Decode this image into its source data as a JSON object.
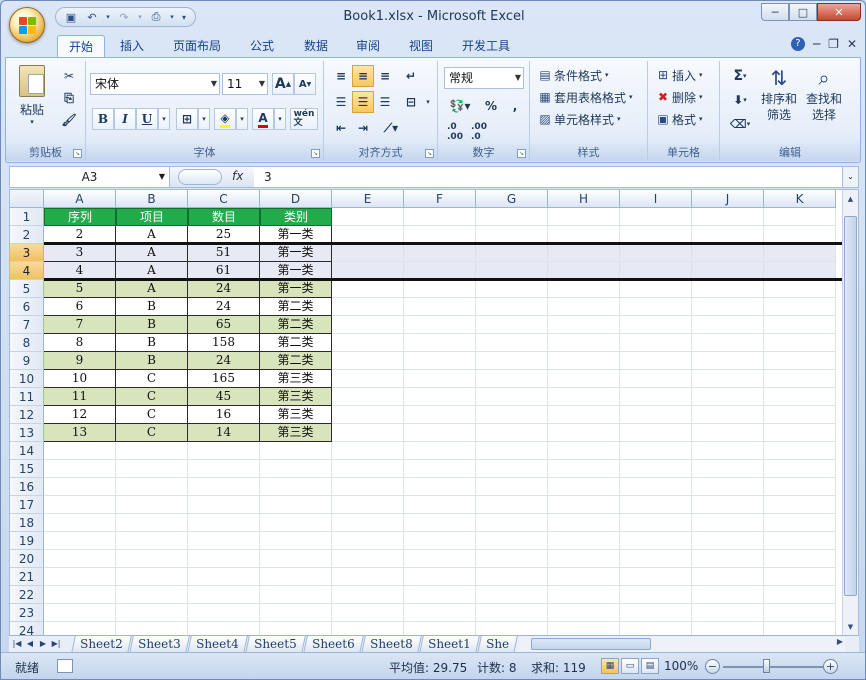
{
  "app": {
    "title": "Book1.xlsx - Microsoft Excel",
    "accent": "#22ab4a",
    "banded_fill": "#d8e4bc"
  },
  "qat": {
    "items": [
      "save-icon",
      "undo-icon",
      "redo-icon",
      "print-preview-icon",
      "customize-icon"
    ]
  },
  "window_controls": {
    "minimize": "─",
    "maximize": "□",
    "close": "✕"
  },
  "tabs": [
    "开始",
    "插入",
    "页面布局",
    "公式",
    "数据",
    "审阅",
    "视图",
    "开发工具"
  ],
  "active_tab": "开始",
  "ribbon": {
    "clipboard": {
      "label": "剪贴板",
      "paste": "粘贴"
    },
    "font": {
      "label": "字体",
      "name": "宋体",
      "size": "11",
      "grow": "A",
      "shrink": "A",
      "bold": "B",
      "italic": "I",
      "underline": "U",
      "color_a": "A",
      "phonetic": "wén\n文"
    },
    "alignment": {
      "label": "对齐方式"
    },
    "number": {
      "label": "数字",
      "format": "常规",
      "percent": "%",
      "comma": ","
    },
    "styles": {
      "label": "样式",
      "conditional": "条件格式",
      "table": "套用表格格式",
      "cell": "单元格样式"
    },
    "cells": {
      "label": "单元格",
      "insert": "插入",
      "delete": "删除",
      "format": "格式"
    },
    "editing": {
      "label": "编辑",
      "sort_filter": "排序和\n筛选",
      "find_select": "查找和\n选择",
      "sum": "Σ"
    }
  },
  "formula_bar": {
    "name_box": "A3",
    "fx": "fx",
    "value": "3"
  },
  "columns": [
    "A",
    "B",
    "C",
    "D",
    "E",
    "F",
    "G",
    "H",
    "I",
    "J",
    "K"
  ],
  "rows": [
    "1",
    "2",
    "3",
    "4",
    "5",
    "6",
    "7",
    "8",
    "9",
    "10",
    "11",
    "12",
    "13",
    "14",
    "15",
    "16",
    "17",
    "18",
    "19",
    "20",
    "21",
    "22",
    "23",
    "24"
  ],
  "table": {
    "header": [
      "序列",
      "项目",
      "数目",
      "类别"
    ],
    "data": [
      [
        "2",
        "A",
        "25",
        "第一类"
      ],
      [
        "3",
        "A",
        "51",
        "第一类"
      ],
      [
        "4",
        "A",
        "61",
        "第一类"
      ],
      [
        "5",
        "A",
        "24",
        "第一类"
      ],
      [
        "6",
        "B",
        "24",
        "第二类"
      ],
      [
        "7",
        "B",
        "65",
        "第二类"
      ],
      [
        "8",
        "B",
        "158",
        "第二类"
      ],
      [
        "9",
        "B",
        "24",
        "第二类"
      ],
      [
        "10",
        "C",
        "165",
        "第三类"
      ],
      [
        "11",
        "C",
        "45",
        "第三类"
      ],
      [
        "12",
        "C",
        "16",
        "第三类"
      ],
      [
        "13",
        "C",
        "14",
        "第三类"
      ]
    ]
  },
  "sheets": [
    "Sheet2",
    "Sheet3",
    "Sheet4",
    "Sheet5",
    "Sheet6",
    "Sheet8",
    "Sheet1",
    "She"
  ],
  "status": {
    "ready": "就绪",
    "average": "平均值: 29.75",
    "count": "计数: 8",
    "sum": "求和: 119",
    "zoom": "100%",
    "zoom_minus": "−",
    "zoom_plus": "+"
  }
}
